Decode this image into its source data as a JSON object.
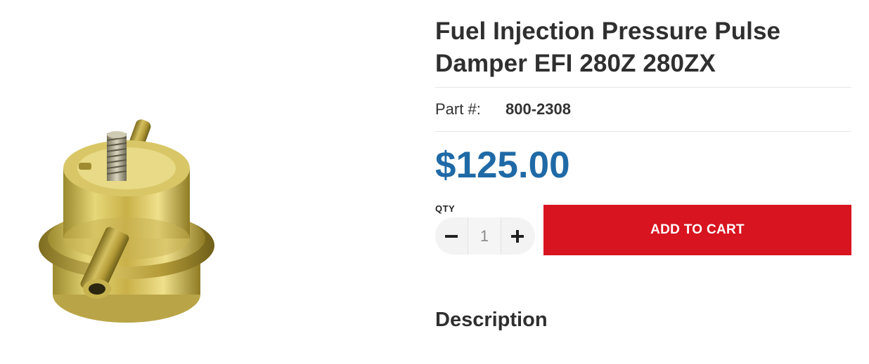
{
  "product": {
    "title": "Fuel Injection Pressure Pulse Damper EFI 280Z 280ZX",
    "part_label": "Part #:",
    "part_number": "800-2308",
    "price": "$125.00",
    "price_color": "#1f6aa6",
    "image_icon": "fuel-pulse-damper-photo"
  },
  "purchase": {
    "qty_label": "QTY",
    "qty_value": "1",
    "decrement_icon": "minus-icon",
    "increment_icon": "plus-icon",
    "add_to_cart_label": "ADD TO CART",
    "add_to_cart_color": "#d7141f"
  },
  "sections": {
    "description_heading": "Description"
  }
}
